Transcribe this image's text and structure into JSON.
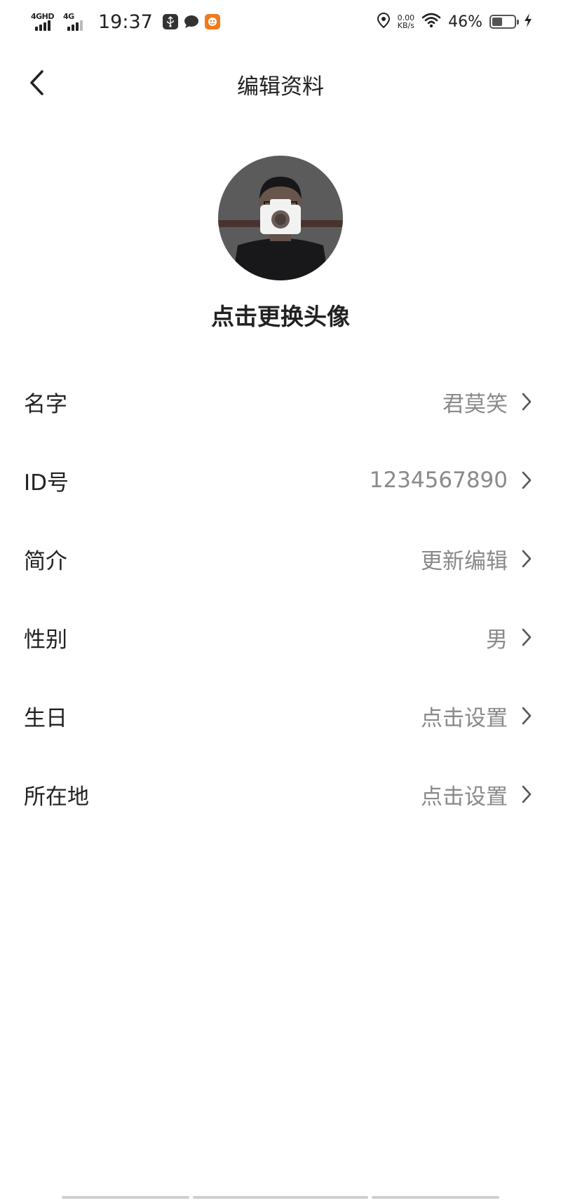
{
  "status_bar": {
    "network_1": "4GHD",
    "network_2": "4G",
    "time": "19:37",
    "net_speed_value": "0.00",
    "net_speed_unit": "KB/s",
    "battery_percent": "46%",
    "battery_level": 0.46
  },
  "header": {
    "title": "编辑资料"
  },
  "avatar": {
    "hint": "点击更换头像"
  },
  "rows": [
    {
      "label": "名字",
      "value": "君莫笑"
    },
    {
      "label": "ID号",
      "value": "1234567890"
    },
    {
      "label": "简介",
      "value": "更新编辑"
    },
    {
      "label": "性别",
      "value": "男"
    },
    {
      "label": "生日",
      "value": "点击设置"
    },
    {
      "label": "所在地",
      "value": "点击设置"
    }
  ],
  "colors": {
    "text_primary": "#222222",
    "text_secondary": "#8a8a8a",
    "background": "#ffffff"
  }
}
